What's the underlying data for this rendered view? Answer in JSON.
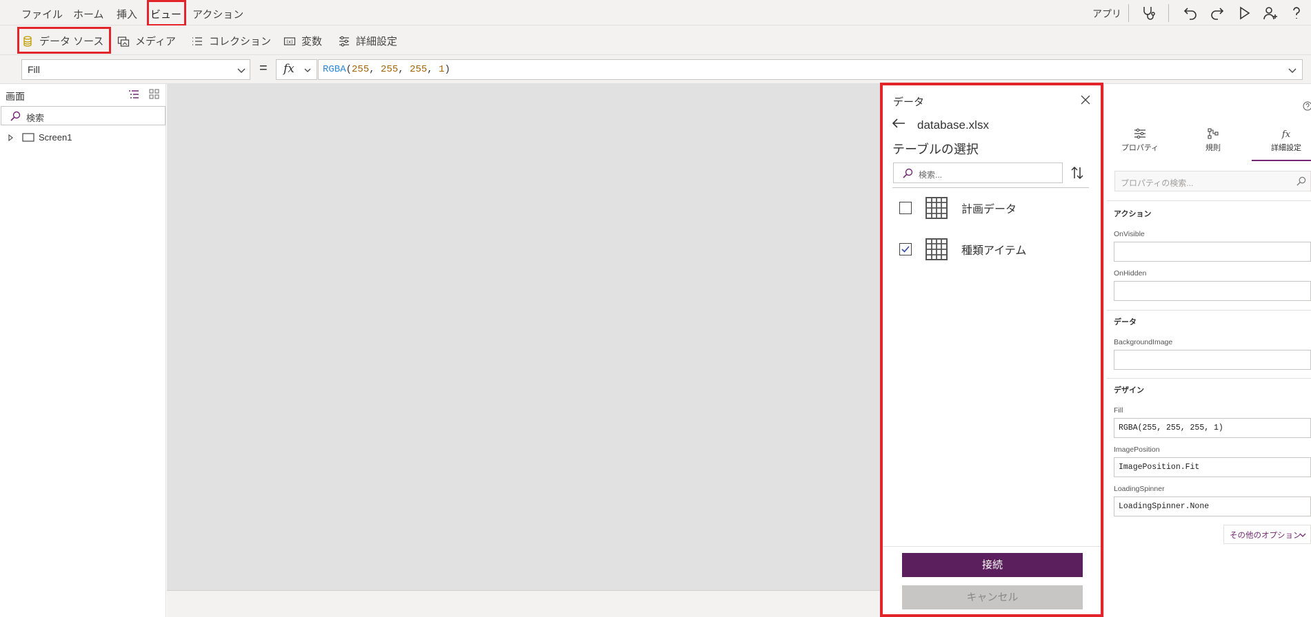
{
  "menu": {
    "items": [
      "ファイル",
      "ホーム",
      "挿入",
      "ビュー",
      "アクション"
    ],
    "right_label": "アプリ"
  },
  "ribbon": {
    "data_source": "データ ソース",
    "media": "メディア",
    "collection": "コレクション",
    "variables": "変数",
    "advanced": "詳細設定"
  },
  "formula_bar": {
    "property": "Fill",
    "equals": "=",
    "fx": "fx",
    "formula_fn": "RGBA",
    "formula_args": [
      "255",
      "255",
      "255",
      "1"
    ]
  },
  "tree": {
    "title": "画面",
    "search_placeholder": "検索",
    "nodes": [
      "Screen1"
    ]
  },
  "data_panel": {
    "title": "データ",
    "file_name": "database.xlsx",
    "subtitle": "テーブルの選択",
    "search_placeholder": "検索...",
    "tables": [
      {
        "name": "計画データ",
        "checked": false
      },
      {
        "name": "種類アイテム",
        "checked": true
      }
    ],
    "connect_label": "接続",
    "cancel_label": "キャンセル"
  },
  "properties_panel": {
    "tabs": [
      "プロパティ",
      "規則",
      "詳細設定"
    ],
    "active_tab": "詳細設定",
    "search_placeholder": "プロパティの検索...",
    "sections": {
      "action": {
        "title": "アクション",
        "fields": [
          {
            "label": "OnVisible",
            "value": ""
          },
          {
            "label": "OnHidden",
            "value": ""
          }
        ]
      },
      "data": {
        "title": "データ",
        "fields": [
          {
            "label": "BackgroundImage",
            "value": ""
          }
        ]
      },
      "design": {
        "title": "デザイン",
        "fields": [
          {
            "label": "Fill",
            "value": "RGBA(255, 255, 255, 1)"
          },
          {
            "label": "ImagePosition",
            "value": "ImagePosition.Fit"
          },
          {
            "label": "LoadingSpinner",
            "value": "LoadingSpinner.None"
          }
        ]
      }
    },
    "more_options": "その他のオプション"
  },
  "colors": {
    "accent": "#742774",
    "connect_button": "#5c1f5d",
    "highlight": "#e3242b",
    "canvas": "#e1e1e1"
  }
}
